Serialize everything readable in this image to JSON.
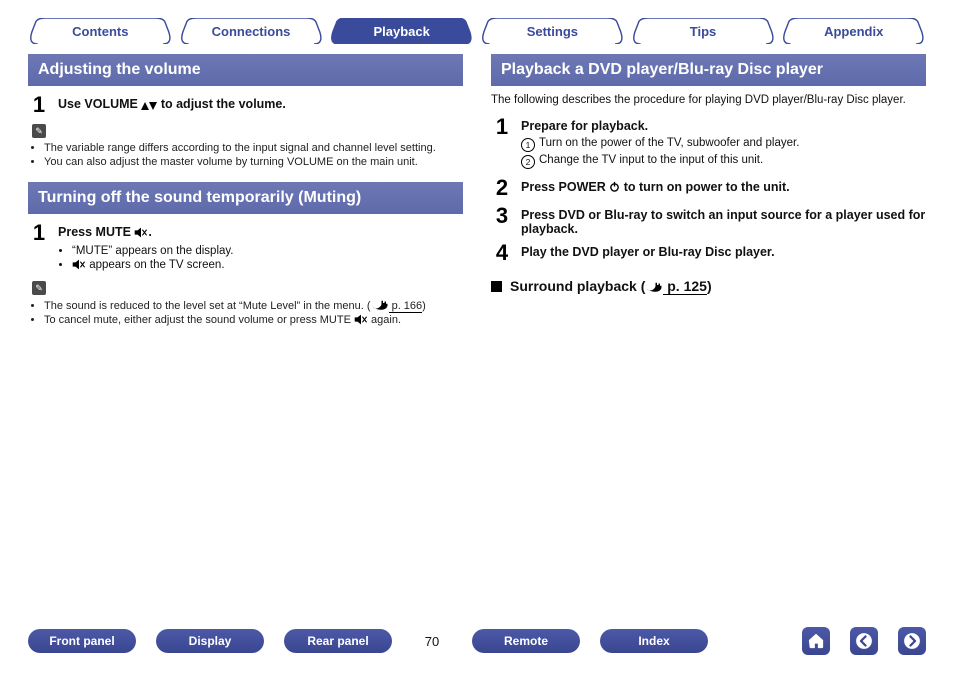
{
  "tabs": {
    "items": [
      {
        "label": "Contents"
      },
      {
        "label": "Connections"
      },
      {
        "label": "Playback",
        "active": true
      },
      {
        "label": "Settings"
      },
      {
        "label": "Tips"
      },
      {
        "label": "Appendix"
      }
    ]
  },
  "left": {
    "sec1": {
      "title": "Adjusting the volume",
      "step1_num": "1",
      "step1_pre": "Use VOLUME ",
      "step1_post": " to adjust the volume.",
      "notes": [
        "The variable range differs according to the input signal and channel level setting.",
        "You can also adjust the master volume by turning VOLUME on the main unit."
      ]
    },
    "sec2": {
      "title": "Turning off the sound temporarily (Muting)",
      "step1_num": "1",
      "step1_pre": "Press MUTE ",
      "step1_post": ".",
      "bullets": [
        "“MUTE” appears on the display.",
        " appears on the TV screen."
      ],
      "note1_pre": "The sound is reduced to the level set at “Mute Level” in the menu.  (",
      "note1_link": " p. 166",
      "note1_post": ")",
      "note2_pre": "To cancel mute, either adjust the sound volume or press MUTE ",
      "note2_post": " again."
    }
  },
  "right": {
    "sec": {
      "title": "Playback a DVD player/Blu-ray Disc player",
      "intro": "The following describes the procedure for playing DVD player/Blu-ray Disc player.",
      "s1_num": "1",
      "s1_title": "Prepare for playback.",
      "s1_a": "Turn on the power of the TV, subwoofer and player.",
      "s1_b": "Change the TV input to the input of this unit.",
      "s2_num": "2",
      "s2_pre": "Press POWER ",
      "s2_post": " to turn on power to the unit.",
      "s3_num": "3",
      "s3_text": "Press DVD or Blu-ray to switch an input source for a player used for playback.",
      "s4_num": "4",
      "s4_text": "Play the DVD player or Blu-ray Disc player.",
      "sub_pre": "Surround playback  (",
      "sub_link": " p. 125",
      "sub_post": ")"
    }
  },
  "bottom": {
    "b1": "Front panel",
    "b2": "Display",
    "b3": "Rear panel",
    "page": "70",
    "b4": "Remote",
    "b5": "Index"
  }
}
